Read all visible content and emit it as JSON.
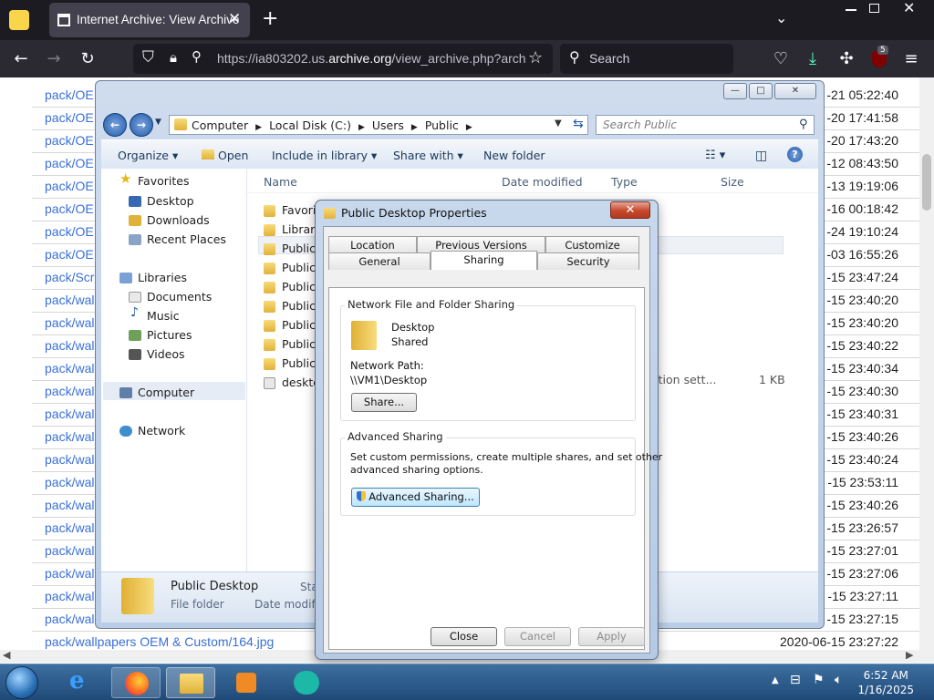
{
  "browser": {
    "tab_title": "Internet Archive: View Archive",
    "url_prefix": "https://ia803202.us.",
    "url_domain": "archive.org",
    "url_suffix": "/view_archive.php?arch",
    "search_placeholder": "Search",
    "badge_count": "5"
  },
  "page_rows": [
    {
      "link": "pack/OE",
      "date": "-21 05:22:40"
    },
    {
      "link": "pack/OE",
      "date": "-20 17:41:58"
    },
    {
      "link": "pack/OE",
      "date": "-20 17:43:20"
    },
    {
      "link": "pack/OE",
      "date": "-12 08:43:50"
    },
    {
      "link": "pack/OE",
      "date": "-13 19:19:06"
    },
    {
      "link": "pack/OE",
      "date": "-16 00:18:42"
    },
    {
      "link": "pack/OE",
      "date": "-24 19:10:24"
    },
    {
      "link": "pack/OE",
      "date": "-03 16:55:26"
    },
    {
      "link": "pack/Scr",
      "date": "-15 23:47:24"
    },
    {
      "link": "pack/wal",
      "date": "-15 23:40:20"
    },
    {
      "link": "pack/wal",
      "date": "-15 23:40:20"
    },
    {
      "link": "pack/wal",
      "date": "-15 23:40:22"
    },
    {
      "link": "pack/wal",
      "date": "-15 23:40:34"
    },
    {
      "link": "pack/wal",
      "date": "-15 23:40:30"
    },
    {
      "link": "pack/wal",
      "date": "-15 23:40:31"
    },
    {
      "link": "pack/wal",
      "date": "-15 23:40:26"
    },
    {
      "link": "pack/wal",
      "date": "-15 23:40:24"
    },
    {
      "link": "pack/wal",
      "date": "-15 23:53:11"
    },
    {
      "link": "pack/wal",
      "date": "-15 23:40:26"
    },
    {
      "link": "pack/wal",
      "date": "-15 23:26:57"
    },
    {
      "link": "pack/wal",
      "date": "-15 23:27:01"
    },
    {
      "link": "pack/wal",
      "date": "-15 23:27:06"
    },
    {
      "link": "pack/wal",
      "date": "-15 23:27:11"
    },
    {
      "link": "pack/wal",
      "date": "-15 23:27:15"
    },
    {
      "link": "pack/wallpapers OEM & Custom/164.jpg",
      "date": "2020-06-15 23:27:22"
    }
  ],
  "explorer": {
    "breadcrumb": [
      "Computer",
      "Local Disk (C:)",
      "Users",
      "Public"
    ],
    "search_placeholder": "Search Public",
    "toolbar": {
      "organize": "Organize",
      "open": "Open",
      "include": "Include in library",
      "share": "Share with",
      "new_folder": "New folder"
    },
    "nav": {
      "favorites": "Favorites",
      "desktop": "Desktop",
      "downloads": "Downloads",
      "recent": "Recent Places",
      "libraries": "Libraries",
      "documents": "Documents",
      "music": "Music",
      "pictures": "Pictures",
      "videos": "Videos",
      "computer": "Computer",
      "network": "Network"
    },
    "columns": {
      "name": "Name",
      "date": "Date modified",
      "type": "Type",
      "size": "Size"
    },
    "files": [
      "Favorit",
      "Librarie",
      "Public",
      "Public",
      "Public",
      "Public",
      "Public",
      "Public",
      "Public",
      "deskto"
    ],
    "desktop_ini_type": "ation sett...",
    "desktop_ini_size": "1 KB",
    "details": {
      "name": "Public Desktop",
      "kind": "File folder",
      "state_label": "Sta",
      "date_label": "Date modifi"
    }
  },
  "dialog": {
    "title": "Public Desktop Properties",
    "tabs_top": [
      "Location",
      "Previous Versions",
      "Customize"
    ],
    "tabs_bottom": [
      "General",
      "Sharing",
      "Security"
    ],
    "nfs_group": "Network File and Folder Sharing",
    "folder_name": "Desktop",
    "folder_state": "Shared",
    "path_label": "Network Path:",
    "path_value": "\\\\VM1\\Desktop",
    "share_button": "Share...",
    "adv_group": "Advanced Sharing",
    "adv_desc1": "Set custom permissions, create multiple shares, and set other",
    "adv_desc2": "advanced sharing options.",
    "adv_button": "Advanced Sharing...",
    "close": "Close",
    "cancel": "Cancel",
    "apply": "Apply"
  },
  "taskbar": {
    "time": "6:52 AM",
    "date": "1/16/2025"
  }
}
